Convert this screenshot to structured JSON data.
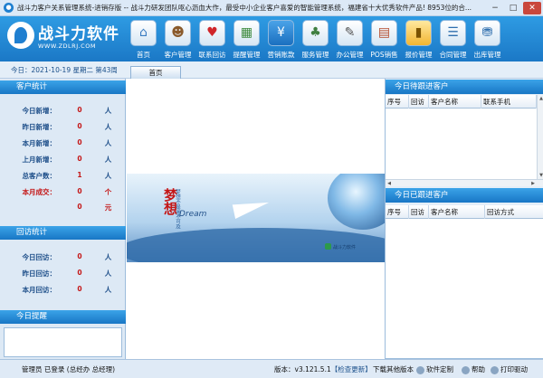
{
  "window": {
    "title": "战斗力客户关系管理系统-进销存版 -- 战斗力研发团队呕心沥血大作，最受中小企业客户喜爱的智能管理系统，福建省十大优秀软件产品! 8953位的合...",
    "min_glyph": "−",
    "max_glyph": "□",
    "close_glyph": "✕"
  },
  "logo": {
    "title": "战斗力软件",
    "url": "WWW.ZDLRJ.COM"
  },
  "toolbar": [
    {
      "label": "首页",
      "icon": "home-icon"
    },
    {
      "label": "客户管理",
      "icon": "customer-icon"
    },
    {
      "label": "联系回访",
      "icon": "heart-icon"
    },
    {
      "label": "提醒管理",
      "icon": "reminder-icon"
    },
    {
      "label": "营销账款",
      "icon": "yen-icon"
    },
    {
      "label": "服务管理",
      "icon": "service-icon"
    },
    {
      "label": "办公管理",
      "icon": "office-icon"
    },
    {
      "label": "POS销售",
      "icon": "pos-icon"
    },
    {
      "label": "报价管理",
      "icon": "quote-icon"
    },
    {
      "label": "合同管理",
      "icon": "contract-icon"
    },
    {
      "label": "出库管理",
      "icon": "outbound-icon"
    }
  ],
  "datebar": {
    "date": "今日：2021-10-19 星期二 第43周",
    "tab_home": "首页"
  },
  "customer_stats": {
    "title": "客户统计",
    "rows": [
      {
        "label": "今日新增：",
        "value": "0",
        "unit": "人"
      },
      {
        "label": "昨日新增：",
        "value": "0",
        "unit": "人"
      },
      {
        "label": "本月新增：",
        "value": "0",
        "unit": "人"
      },
      {
        "label": "上月新增：",
        "value": "0",
        "unit": "人"
      },
      {
        "label": "总客户数：",
        "value": "1",
        "unit": "人"
      },
      {
        "label": "本月成交：",
        "value": "0",
        "unit": "个"
      },
      {
        "label": "",
        "value": "0",
        "unit": "元"
      }
    ]
  },
  "visit_stats": {
    "title": "回访统计",
    "rows": [
      {
        "label": "今日回访：",
        "value": "0",
        "unit": "人"
      },
      {
        "label": "昨日回访：",
        "value": "0",
        "unit": "人"
      },
      {
        "label": "本月回访：",
        "value": "0",
        "unit": "人"
      }
    ]
  },
  "reminder": {
    "title": "今日提醒"
  },
  "banner": {
    "char": "梦想",
    "en": "Dream",
    "vertical": "梦想不是遥不可及",
    "brand": "战斗力软件"
  },
  "pending_followup": {
    "title": "今日待跟进客户",
    "columns": [
      "序号",
      "回访",
      "客户名称",
      "联系手机"
    ]
  },
  "done_followup": {
    "title": "今日已跟进客户",
    "columns": [
      "序号",
      "回访",
      "客户名称",
      "回访方式"
    ]
  },
  "statusbar": {
    "user": "管理员 已登录 (总经办 总经理)",
    "version_label": "版本：v3.121.5.1",
    "check_update": "【检查更新】",
    "download_other": "下载其他版本",
    "custom": "软件定制",
    "help": "帮助",
    "print_driver": "打印驱动"
  },
  "colors": {
    "header": "#1f86d6",
    "section_header": "#2a8dd9",
    "stat_value": "#c41616",
    "label": "#1d4e89"
  }
}
